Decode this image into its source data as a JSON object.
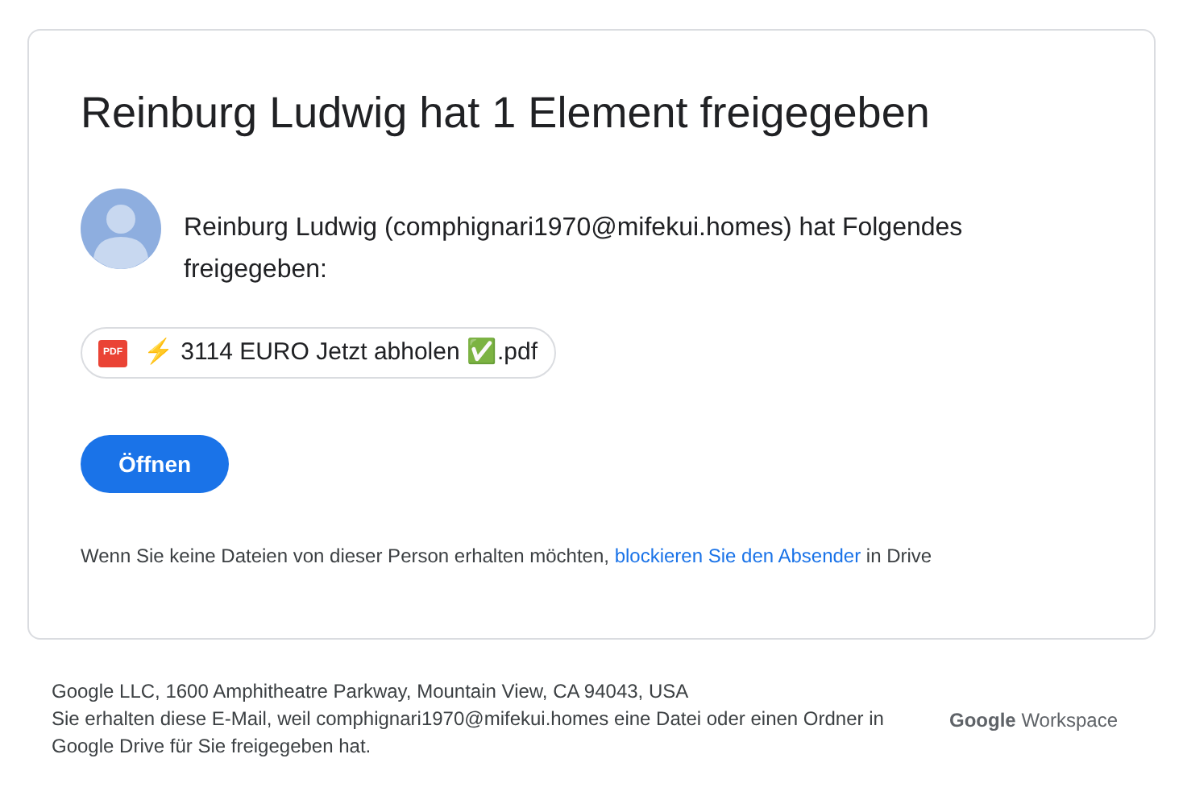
{
  "card": {
    "title": "Reinburg Ludwig hat 1 Element freigegeben",
    "message": "Reinburg Ludwig (comphignari1970@mifekui.homes) hat Folgendes freigegeben:",
    "file": {
      "icon_label": "PDF",
      "name": "⚡ 3114 EURO Jetzt abholen ✅.pdf"
    },
    "open_button": "Öffnen",
    "block_notice": {
      "before": "Wenn Sie keine Dateien von dieser Person erhalten möchten, ",
      "link": "blockieren Sie den Absender",
      "after": " in Drive"
    }
  },
  "footer": {
    "lines": [
      "Google LLC, 1600 Amphitheatre Parkway, Mountain View, CA 94043, USA",
      "Sie erhalten diese E-Mail, weil comphignari1970@mifekui.homes eine Datei oder einen Ordner in Google Drive für Sie freigegeben hat."
    ],
    "logo": {
      "brand": "Google",
      "product": "Workspace"
    }
  }
}
